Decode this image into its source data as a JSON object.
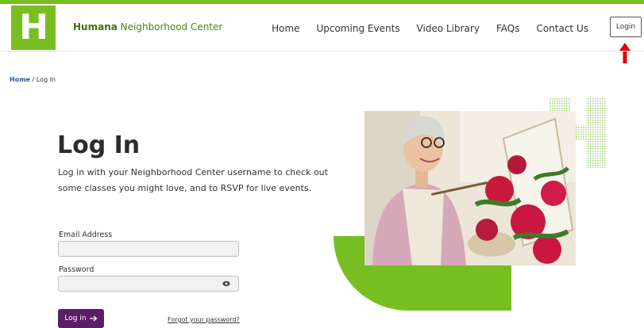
{
  "header": {
    "logo_letter": "H",
    "brand_bold": "Humana",
    "brand_rest": " Neighborhood Center",
    "nav": [
      "Home",
      "Upcoming Events",
      "Video Library",
      "FAQs",
      "Contact Us"
    ],
    "login_label": "Login"
  },
  "breadcrumb": {
    "home": "Home",
    "sep": " / ",
    "current": "Log In"
  },
  "main": {
    "title": "Log In",
    "intro": "Log in with your Neighborhood Center username to check out some classes you might love, and to RSVP for live events."
  },
  "form": {
    "email_label": "Email Address",
    "email_value": "",
    "password_label": "Password",
    "password_value": "",
    "submit_label": "Log in",
    "forgot_label": "Forgot your password?"
  },
  "colors": {
    "brand_green": "#78be20",
    "brand_purple": "#5b1e66",
    "annotation_red": "#e00000"
  },
  "icons": {
    "eye": "eye-icon",
    "arrow_right": "arrow-right-icon",
    "annotation": "arrow-up-icon"
  }
}
